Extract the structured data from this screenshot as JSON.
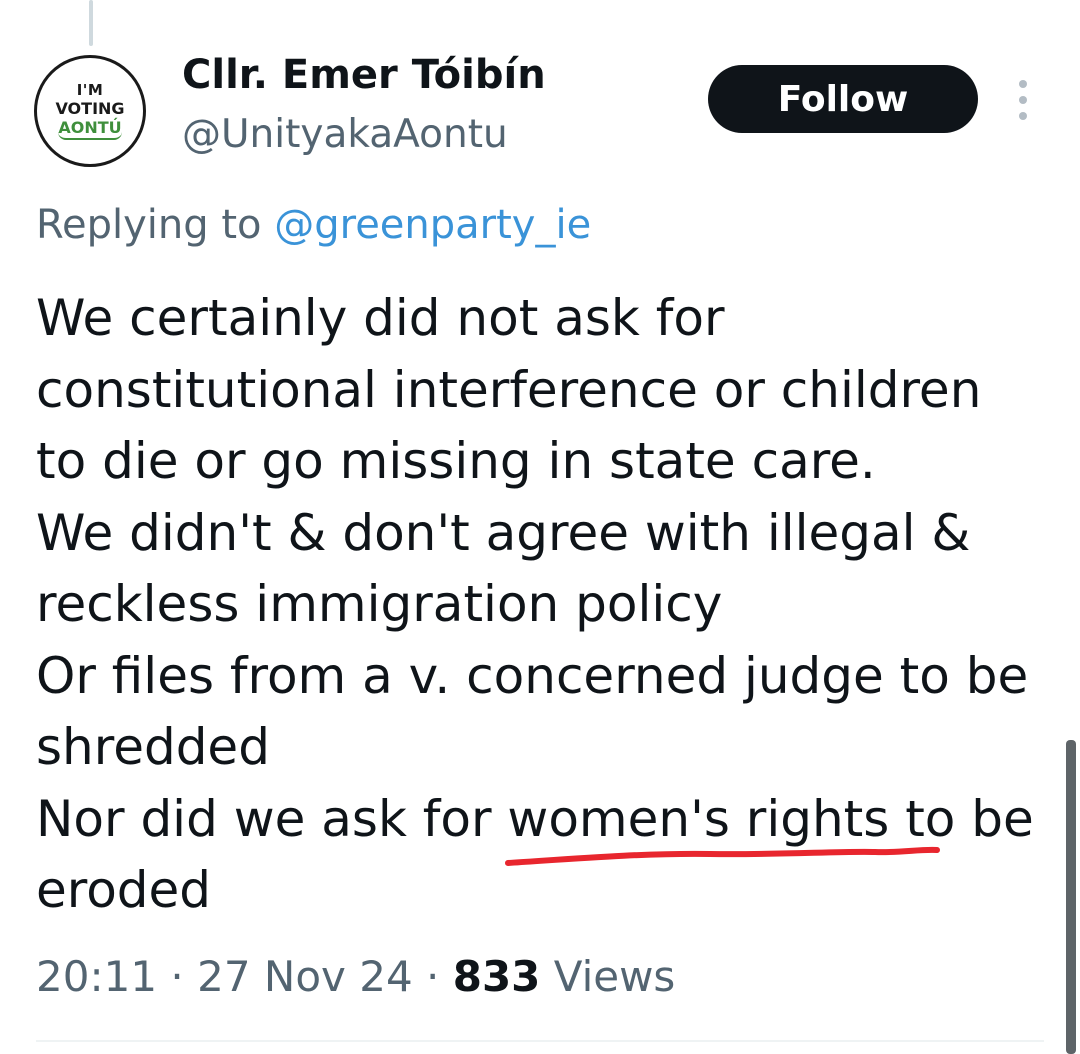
{
  "avatar": {
    "line1": "I'M",
    "line2": "VOTING",
    "line3": "AONTÚ"
  },
  "author": {
    "display_name": "Cllr. Emer Tóibín",
    "handle": "@UnityakaAontu"
  },
  "follow_button": {
    "label": "Follow"
  },
  "reply": {
    "prefix": "Replying to ",
    "mention": "@greenparty_ie"
  },
  "tweet": {
    "lines": [
      "We certainly did not ask for",
      "constitutional interference or children",
      "to die or go missing in state care.",
      "We didn't & don't agree with illegal &",
      "reckless immigration policy",
      "Or files from a v. concerned judge to be",
      "shredded",
      "Nor did we ask for women's rights to be",
      "eroded"
    ]
  },
  "meta": {
    "time": "20:11",
    "separator": " · ",
    "date": "27 Nov 24",
    "views_count": "833",
    "views_label": " Views"
  },
  "colors": {
    "text": "#0f1419",
    "secondary": "#536471",
    "link": "#3a93d8",
    "button_bg": "#0f1419",
    "annotation": "#e8262e"
  },
  "icons": {
    "more": "more-vertical-icon"
  }
}
